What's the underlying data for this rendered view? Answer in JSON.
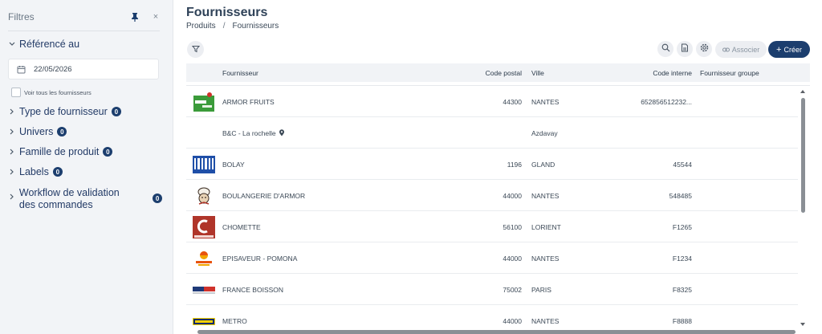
{
  "sidebar": {
    "title": "Filtres",
    "close": "×",
    "referenced": {
      "label": "Référencé au",
      "date": "22/05/2026"
    },
    "show_all_label": "Voir tous les fournisseurs",
    "sections": [
      {
        "label": "Type de fournisseur",
        "count": "0"
      },
      {
        "label": "Univers",
        "count": "0"
      },
      {
        "label": "Famille de produit",
        "count": "0"
      },
      {
        "label": "Labels",
        "count": "0"
      },
      {
        "label": "Workflow de validation des commandes",
        "count": "0"
      }
    ]
  },
  "header": {
    "title": "Fournisseurs",
    "breadcrumb": [
      "Produits",
      "Fournisseurs"
    ],
    "breadcrumb_sep": "/"
  },
  "toolbar": {
    "associate_label": "Associer",
    "create_plus": "+",
    "create_label": "Créer"
  },
  "table": {
    "columns": [
      "Fournisseur",
      "Code postal",
      "Ville",
      "Code interne",
      "Fournisseur groupe"
    ],
    "rows": [
      {
        "logo": "armor-fruits-logo",
        "name": "ARMOR FRUITS",
        "postal": "44300",
        "city": "NANTES",
        "code": "652856512232...",
        "group": ""
      },
      {
        "logo": "",
        "name": "B&C - La rochelle",
        "postal": "",
        "city": "Azdavay",
        "code": "",
        "group": "",
        "location": true
      },
      {
        "logo": "bolay-logo",
        "name": "BOLAY",
        "postal": "1196",
        "city": "GLAND",
        "code": "45544",
        "group": ""
      },
      {
        "logo": "boulangerie-logo",
        "name": "BOULANGERIE D'ARMOR",
        "postal": "44000",
        "city": "NANTES",
        "code": "548485",
        "group": ""
      },
      {
        "logo": "chomette-logo",
        "name": "CHOMETTE",
        "postal": "56100",
        "city": "LORIENT",
        "code": "F1265",
        "group": ""
      },
      {
        "logo": "episaveur-logo",
        "name": "EPISAVEUR - POMONA",
        "postal": "44000",
        "city": "NANTES",
        "code": "F1234",
        "group": ""
      },
      {
        "logo": "france-boisson-logo",
        "name": "FRANCE BOISSON",
        "postal": "75002",
        "city": "PARIS",
        "code": "F8325",
        "group": ""
      },
      {
        "logo": "metro-logo",
        "name": "METRO",
        "postal": "44000",
        "city": "NANTES",
        "code": "F8888",
        "group": ""
      }
    ]
  },
  "colors": {
    "primary": "#1c3e6e",
    "accent_red": "#b0352a",
    "sidebar_bg": "#f2f4f7"
  }
}
